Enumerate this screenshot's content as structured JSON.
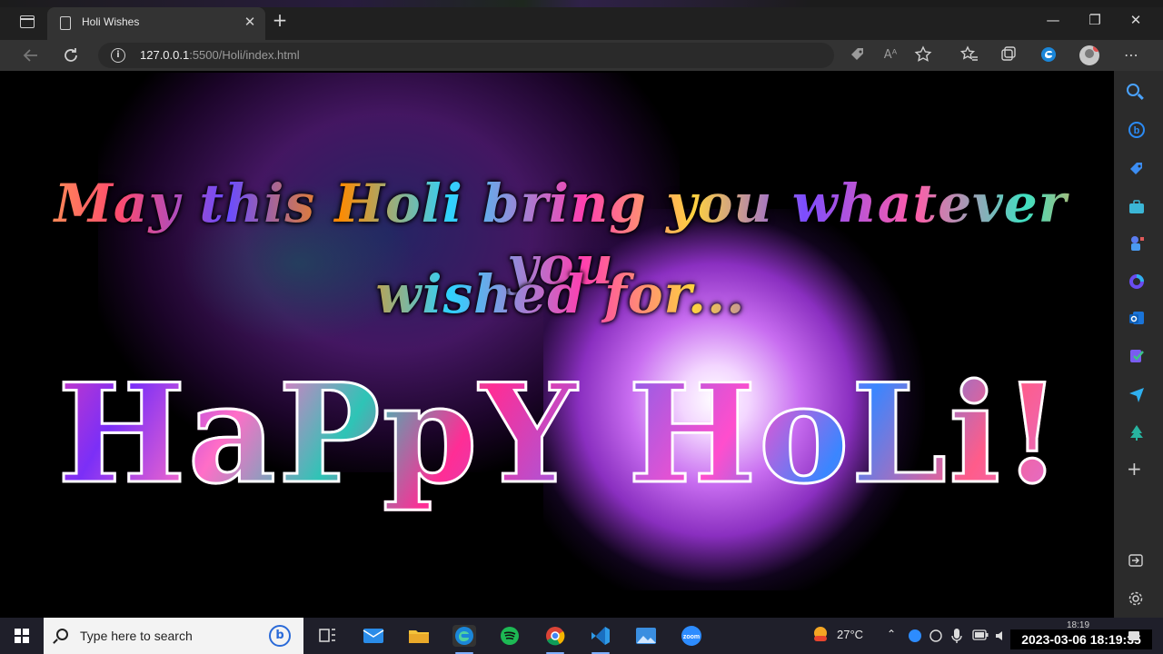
{
  "browser": {
    "tab_title": "Holi Wishes",
    "url_host": "127.0.0.1",
    "url_rest": ":5500/Holi/index.html",
    "new_tab": "+",
    "tab_close": "✕",
    "minimize": "—",
    "maximize": "❐",
    "close": "✕"
  },
  "page": {
    "wish_line1": "May this Holi bring you whatever you",
    "wish_line2": "wished for...",
    "greeting": "HaPpY HoLi!"
  },
  "taskbar": {
    "search_placeholder": "Type here to search",
    "weather": "27°C",
    "time_small": "18:19",
    "datetime": "2023-03-06  18:19:35"
  },
  "colors": {
    "accent": "#4aa3ff",
    "edge_blue": "#0f7bd8",
    "taskbar": "#1f1f2a"
  },
  "icons": [
    "back-arrow-icon",
    "reload-icon",
    "info-icon",
    "tag-icon",
    "read-aloud-icon",
    "favorite-add-icon",
    "favorites-icon",
    "collections-icon",
    "edge-copilot-icon",
    "profile-icon",
    "more-icon"
  ]
}
